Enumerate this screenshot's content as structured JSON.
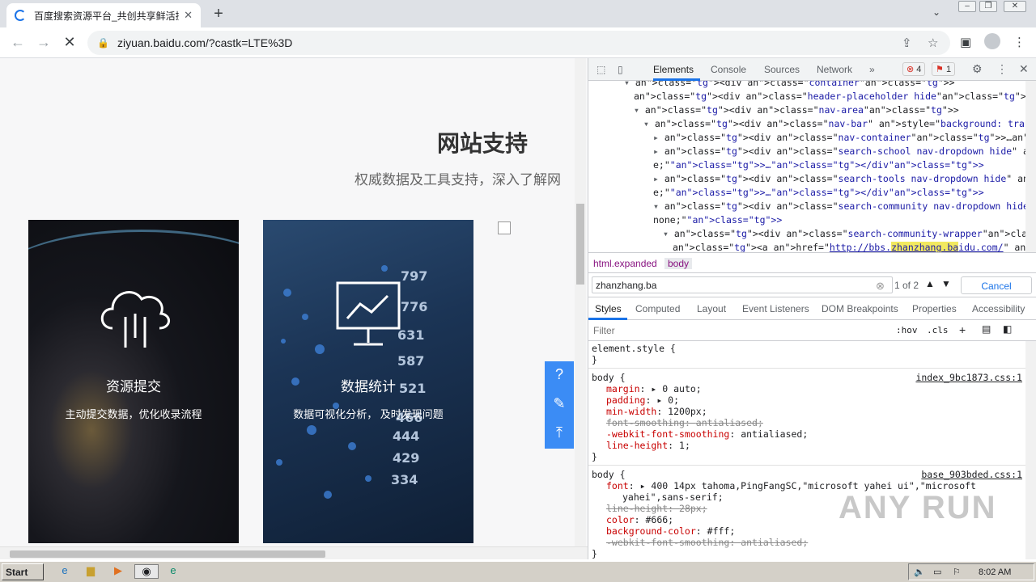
{
  "browser": {
    "tab_title": "百度搜索资源平台_共创共享鲜活搜",
    "tab_close": "✕",
    "new_tab": "+",
    "tab_menu": "⌄",
    "url": "ziyuan.baidu.com/?castk=LTE%3D",
    "back": "←",
    "forward": "→",
    "reload": "✕"
  },
  "page": {
    "title": "网站支持",
    "subtitle": "权威数据及工具支持，深入了解网",
    "cards": [
      {
        "heading": "资源提交",
        "desc": "主动提交数据，优化收录流程"
      },
      {
        "heading": "数据统计",
        "desc": "数据可视化分析， 及时发现问题"
      }
    ],
    "float_icons": [
      "help-icon",
      "edit-icon",
      "back-to-top-icon"
    ]
  },
  "devtools": {
    "tabs": [
      "Elements",
      "Console",
      "Sources",
      "Network",
      "»"
    ],
    "errors": "4",
    "issues": "1",
    "dom_lines": [
      {
        "indent": 0,
        "arrow": "▾",
        "html": "<div class=\"container\">"
      },
      {
        "indent": 1,
        "arrow": "",
        "html": "<div class=\"header-placeholder hide\"> </div>"
      },
      {
        "indent": 1,
        "arrow": "▾",
        "html": "<div class=\"nav-area\">"
      },
      {
        "indent": 2,
        "arrow": "▾",
        "html": "<div class=\"nav-bar\" style=\"background: transparent;\">"
      },
      {
        "indent": 3,
        "arrow": "▸",
        "html": "<div class=\"nav-container\">…</div>"
      },
      {
        "indent": 3,
        "arrow": "▸",
        "html": "<div class=\"search-school nav-dropdown hide\" style=\"display: non"
      },
      {
        "indent": 3,
        "arrow": "",
        "html": "e;\">…</div>"
      },
      {
        "indent": 3,
        "arrow": "▸",
        "html": "<div class=\"search-tools nav-dropdown hide\" style=\"display: non"
      },
      {
        "indent": 3,
        "arrow": "",
        "html": "e;\">…</div>"
      },
      {
        "indent": 3,
        "arrow": "▾",
        "html": "<div class=\"search-community nav-dropdown hide\" style=\"display:"
      },
      {
        "indent": 3,
        "arrow": "",
        "html": "none;\">"
      },
      {
        "indent": 4,
        "arrow": "▾",
        "html": "<div class=\"search-community-wrapper\">"
      },
      {
        "indent": 5,
        "arrow": "",
        "html": "<a href=\"http://bbs.zhanzhang.baidu.com/\" target=\"_blank\">"
      }
    ],
    "breadcrumbs": [
      "html.expanded",
      "body"
    ],
    "find_value": "zhanzhang.ba",
    "find_count": "1 of 2",
    "find_cancel": "Cancel",
    "style_tabs": [
      "Styles",
      "Computed",
      "Layout",
      "Event Listeners",
      "DOM Breakpoints",
      "Properties",
      "Accessibility"
    ],
    "filter_placeholder": "Filter",
    "hov": ":hov",
    "cls": ".cls",
    "rules": [
      {
        "selector": "element.style {",
        "source": "",
        "props": []
      },
      {
        "selector": "body {",
        "source": "index_9bc1873.css:1",
        "props": [
          {
            "name": "margin",
            "value": "▸ 0 auto;",
            "strike": false
          },
          {
            "name": "padding",
            "value": "▸ 0;",
            "strike": false
          },
          {
            "name": "min-width",
            "value": "1200px;",
            "strike": false
          },
          {
            "name": "font-smoothing",
            "value": "antialiased;",
            "strike": true
          },
          {
            "name": "-webkit-font-smoothing",
            "value": "antialiased;",
            "strike": false
          },
          {
            "name": "line-height",
            "value": "1;",
            "strike": false
          }
        ]
      },
      {
        "selector": "body {",
        "source": "base_903bded.css:1",
        "props": [
          {
            "name": "font",
            "value": "▸ 400 14px tahoma,PingFangSC,\"microsoft yahei ui\",\"microsoft",
            "strike": false
          },
          {
            "name": "",
            "value": "yahei\",sans-serif;",
            "strike": false
          },
          {
            "name": "line-height",
            "value": "28px;",
            "strike": true
          },
          {
            "name": "color",
            "value": "#666;",
            "strike": false
          },
          {
            "name": "background-color",
            "value": "#fff;",
            "strike": false
          },
          {
            "name": "-webkit-font-smoothing",
            "value": "antialiased;",
            "strike": true
          }
        ]
      }
    ]
  },
  "taskbar": {
    "start": "Start",
    "clock": "8:02 AM"
  },
  "watermark": "ANY RUN"
}
